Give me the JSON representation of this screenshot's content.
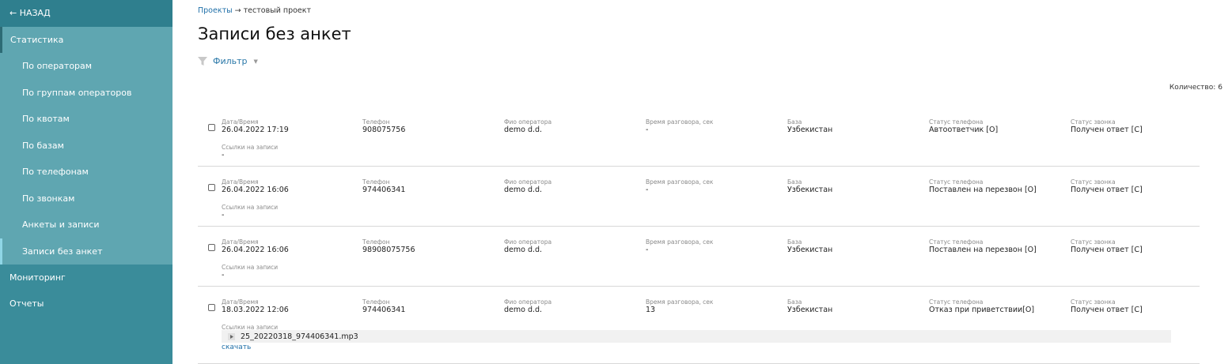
{
  "sidebar": {
    "back_label": "← НАЗАД",
    "section_stats": "Статистика",
    "items": [
      {
        "label": "По операторам"
      },
      {
        "label": "По группам операторов"
      },
      {
        "label": "По квотам"
      },
      {
        "label": "По базам"
      },
      {
        "label": "По телефонам"
      },
      {
        "label": "По звонкам"
      },
      {
        "label": "Анкеты и записи"
      },
      {
        "label": "Записи без анкет"
      }
    ],
    "section_monitoring": "Мониторинг",
    "section_reports": "Отчеты"
  },
  "breadcrumb": {
    "projects_link": "Проекты",
    "arrow": "→",
    "current": "тестовый проект"
  },
  "page_title": "Записи без анкет",
  "filter": {
    "label": "Фильтр",
    "caret": "▼",
    "icon": "funnel-icon"
  },
  "count": {
    "label": "Количество:",
    "value": "6"
  },
  "field_labels": {
    "datetime": "Дата/Время",
    "phone": "Телефон",
    "operator": "Фио оператора",
    "talk_time": "Время разговора, сек",
    "base": "База",
    "phone_status": "Статус телефона",
    "call_status": "Статус звонка",
    "links": "Ссылки на записи"
  },
  "records": [
    {
      "datetime": "26.04.2022 17:19",
      "phone": "908075756",
      "operator": "demo d.d.",
      "talk_time": "-",
      "base": "Узбекистан",
      "phone_status": "Автоответчик [О]",
      "call_status": "Получен ответ [С]",
      "links": "-"
    },
    {
      "datetime": "26.04.2022 16:06",
      "phone": "974406341",
      "operator": "demo d.d.",
      "talk_time": "-",
      "base": "Узбекистан",
      "phone_status": "Поставлен на перезвон [О]",
      "call_status": "Получен ответ [С]",
      "links": "-"
    },
    {
      "datetime": "26.04.2022 16:06",
      "phone": "98908075756",
      "operator": "demo d.d.",
      "talk_time": "-",
      "base": "Узбекистан",
      "phone_status": "Поставлен на перезвон [О]",
      "call_status": "Получен ответ [С]",
      "links": "-"
    },
    {
      "datetime": "18.03.2022 12:06",
      "phone": "974406341",
      "operator": "demo d.d.",
      "talk_time": "13",
      "base": "Узбекистан",
      "phone_status": "Отказ при приветствии[О]",
      "call_status": "Получен ответ [С]",
      "audio_file": "25_20220318_974406341.mp3",
      "download_label": "скачать"
    }
  ],
  "colors": {
    "sidebar": "#3a8c9a",
    "sidebar_sub": "#5fa6b1",
    "link": "#1f6fa8"
  }
}
